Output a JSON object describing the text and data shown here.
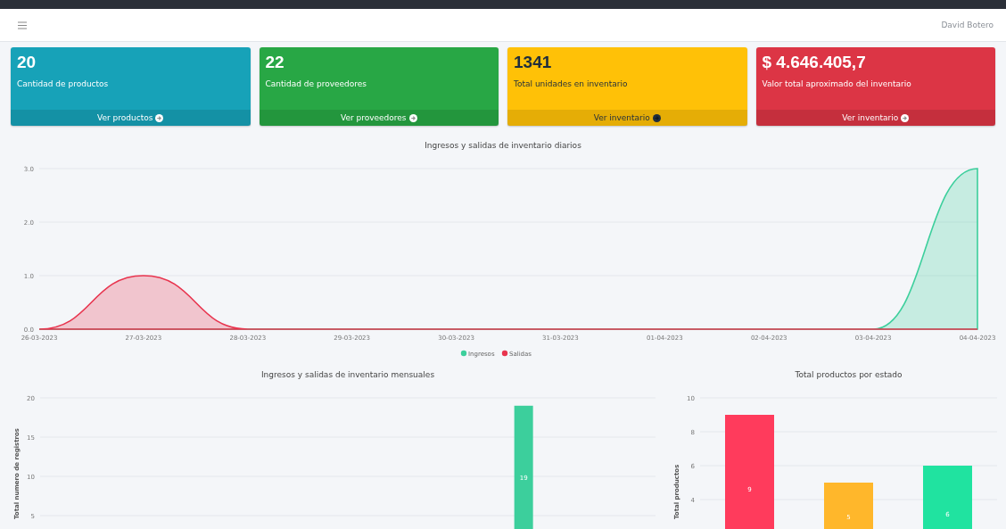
{
  "navbar": {
    "user": "David Botero"
  },
  "stat_cards": [
    {
      "value": "20",
      "label": "Cantidad de productos",
      "link": "Ver productos",
      "color": "#17a2b8"
    },
    {
      "value": "22",
      "label": "Cantidad de proveedores",
      "link": "Ver proveedores",
      "color": "#28a745"
    },
    {
      "value": "1341",
      "label": "Total unidades en inventario",
      "link": "Ver inventario",
      "color": "#ffc107"
    },
    {
      "value": "$ 4.646.405,7",
      "label": "Valor total aproximado del inventario",
      "link": "Ver inventario",
      "color": "#dc3545"
    }
  ],
  "daily_chart": {
    "chart_data": {
      "type": "area",
      "title": "Ingresos y salidas de inventario diarios",
      "x": [
        "26-03-2023",
        "27-03-2023",
        "28-03-2023",
        "29-03-2023",
        "30-03-2023",
        "31-03-2023",
        "01-04-2023",
        "02-04-2023",
        "03-04-2023",
        "04-04-2023"
      ],
      "series": [
        {
          "name": "Ingresos",
          "color": "#3ccf9c",
          "values": [
            0,
            0,
            0,
            0,
            0,
            0,
            0,
            0,
            0,
            3
          ]
        },
        {
          "name": "Salidas",
          "color": "#e8344e",
          "values": [
            0,
            1,
            0,
            0,
            0,
            0,
            0,
            0,
            0,
            0
          ]
        }
      ],
      "legend": "bottom",
      "grid": true,
      "ylim": [
        0,
        3
      ],
      "yticks": [
        {
          "value": 0,
          "label": "0.0"
        },
        {
          "value": 1,
          "label": "1.0"
        },
        {
          "value": 2,
          "label": "2.0"
        },
        {
          "value": 3,
          "label": "3.0"
        }
      ]
    }
  },
  "monthly_chart": {
    "chart_data": {
      "type": "bar",
      "title": "Ingresos y salidas de inventario mensuales",
      "ylabel": "Total numero de registros",
      "series": [
        {
          "color": "#3ccf9c",
          "values": [
            null,
            null,
            null,
            null,
            null,
            19,
            null
          ]
        }
      ],
      "grid": true,
      "ylim": [
        0,
        20
      ],
      "yticks": [
        5,
        10,
        15,
        20
      ],
      "data_labels": true
    }
  },
  "status_chart": {
    "chart_data": {
      "type": "bar",
      "title": "Total productos por estado",
      "ylabel": "Total productos",
      "series": [
        {
          "values": [
            9,
            5,
            6
          ],
          "colors": [
            "#ff3b5c",
            "#ffb72b",
            "#20e3a0"
          ]
        }
      ],
      "grid": true,
      "ylim": [
        0,
        10
      ],
      "yticks": [
        4,
        6,
        8,
        10
      ],
      "data_labels": true
    }
  }
}
